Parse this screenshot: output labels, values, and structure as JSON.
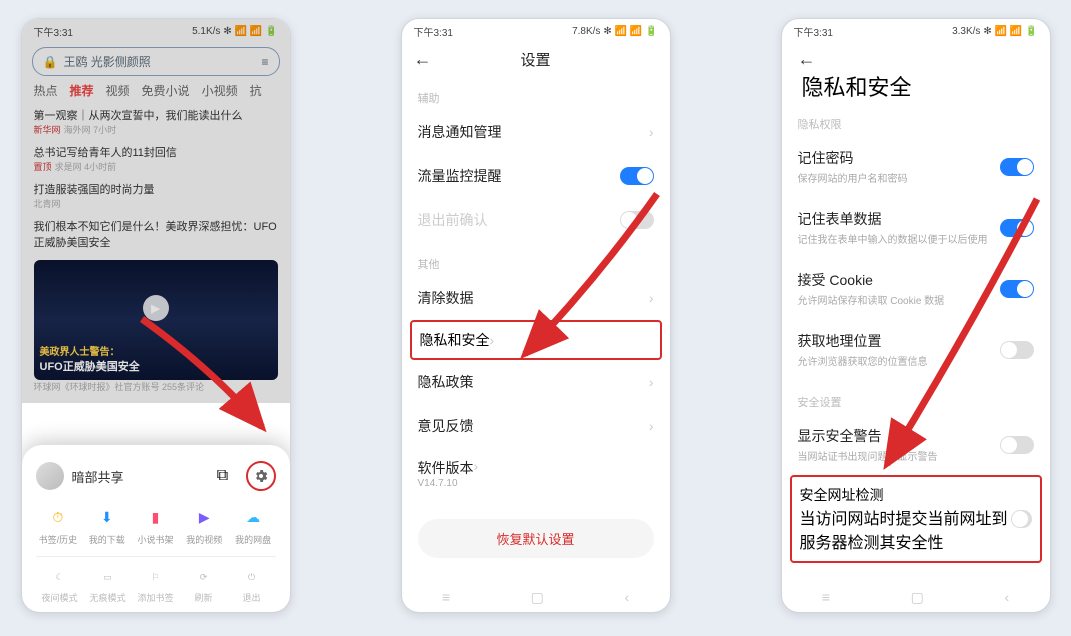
{
  "status": {
    "time": "下午3:31",
    "net1": "5.1K/s",
    "net2": "7.8K/s",
    "net3": "3.3K/s"
  },
  "phone1": {
    "search_text": "王鸥 光影侧颜照",
    "tabs": [
      "热点",
      "推荐",
      "视频",
      "免费小说",
      "小视频",
      "抗"
    ],
    "feed": [
      {
        "title": "第一观察｜从两次宣誓中，我们能读出什么",
        "src": "新华网",
        "meta": "海外网 7小时"
      },
      {
        "title": "总书记写给青年人的11封回信",
        "src": "置顶",
        "meta": "求是网 4小时前"
      },
      {
        "title": "打造服装强国的时尚力量",
        "meta": "北青网"
      },
      {
        "title": "我们根本不知它们是什么！美政界深感担忧：UFO正威胁美国安全"
      }
    ],
    "video": {
      "cap1": "美政界人士警告：",
      "cap2": "UFO正威胁美国安全",
      "meta": "环球网《环球时报》社官方账号 255条评论"
    },
    "sheet": {
      "user": "暗部共享",
      "row1": [
        "书签/历史",
        "我的下载",
        "小说书架",
        "我的视频",
        "我的网盘"
      ],
      "row2": [
        "夜间模式",
        "无痕模式",
        "添加书签",
        "刷新",
        "退出"
      ]
    }
  },
  "phone2": {
    "title": "设置",
    "sec1": "辅助",
    "rows1": [
      {
        "label": "消息通知管理",
        "type": "chev"
      },
      {
        "label": "流量监控提醒",
        "type": "toggle",
        "on": true
      },
      {
        "label": "退出前确认",
        "type": "toggle",
        "on": false
      }
    ],
    "sec2": "其他",
    "rows2": [
      {
        "label": "清除数据",
        "type": "chev"
      },
      {
        "label": "隐私和安全",
        "type": "chev",
        "highlight": true
      },
      {
        "label": "隐私政策",
        "type": "chev"
      },
      {
        "label": "意见反馈",
        "type": "chev"
      }
    ],
    "version_label": "软件版本",
    "version_value": "V14.7.10",
    "reset": "恢复默认设置"
  },
  "phone3": {
    "title": "隐私和安全",
    "sec1": "隐私权限",
    "rows1": [
      {
        "label": "记住密码",
        "sub": "保存网站的用户名和密码",
        "on": true
      },
      {
        "label": "记住表单数据",
        "sub": "记住我在表单中输入的数据以便于以后使用",
        "on": true
      },
      {
        "label": "接受 Cookie",
        "sub": "允许网站保存和读取 Cookie 数据",
        "on": true
      },
      {
        "label": "获取地理位置",
        "sub": "允许浏览器获取您的位置信息",
        "on": false
      }
    ],
    "sec2": "安全设置",
    "rows2": [
      {
        "label": "显示安全警告",
        "sub": "当网站证书出现问题时显示警告",
        "on": false
      },
      {
        "label": "安全网址检测",
        "sub": "当访问网站时提交当前网址到服务器检测其安全性",
        "on": false,
        "highlight": true
      }
    ]
  }
}
